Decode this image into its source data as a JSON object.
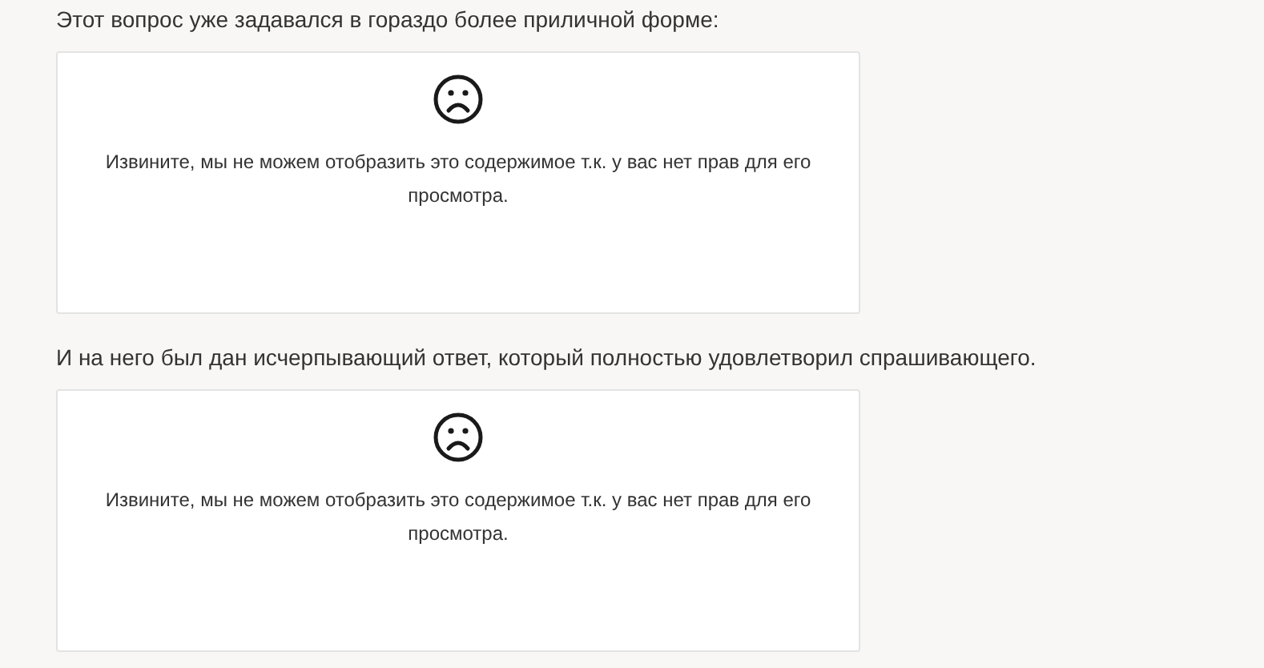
{
  "blocks": [
    {
      "kind": "paragraph",
      "text": "Этот вопрос уже задавался в гораздо более приличной форме:"
    },
    {
      "kind": "restricted",
      "message": "Извините, мы не можем отобразить это содержимое т.к. у вас нет прав для его просмотра."
    },
    {
      "kind": "paragraph",
      "text": "И на него был дан исчерпывающий ответ, который полностью удовлетворил спрашивающего."
    },
    {
      "kind": "restricted",
      "message": "Извините, мы не можем отобразить это содержимое т.к. у вас нет прав для его просмотра."
    }
  ]
}
